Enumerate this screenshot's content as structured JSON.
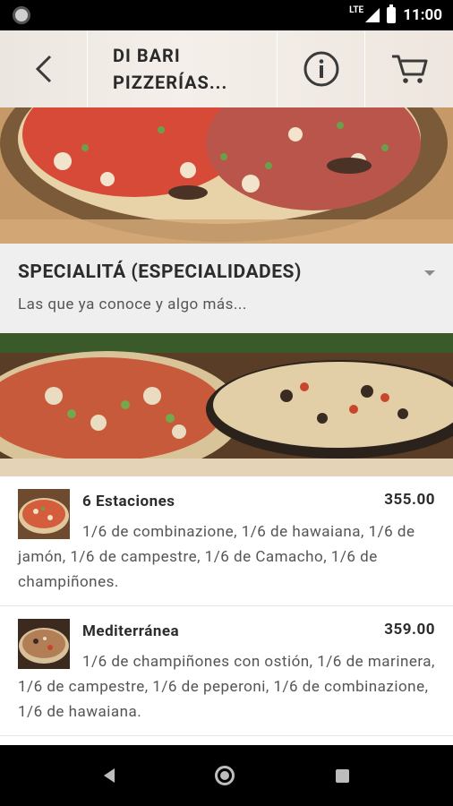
{
  "status_bar": {
    "network": "LTE",
    "time": "11:00"
  },
  "header": {
    "title": "DI BARI PIZZERÍAS...",
    "back_icon": "back-arrow-icon",
    "info_icon": "info-icon",
    "cart_icon": "cart-icon"
  },
  "section": {
    "title": "SPECIALITÁ (ESPECIALIDADES)",
    "subtitle": "Las que ya conoce y algo más...",
    "toggle_icon": "dropdown-arrow-icon"
  },
  "items": [
    {
      "name": "6 Estaciones",
      "price": "355.00",
      "description": "1/6 de combinazione, 1/6 de hawaiana, 1/6 de jamón, 1/6 de campestre, 1/6 de Camacho, 1/6 de champiñones."
    },
    {
      "name": "Mediterránea",
      "price": "359.00",
      "description": "1/6 de champiñones con ostión, 1/6 de marinera, 1/6 de campestre, 1/6 de peperoni, 1/6 de combinazione, 1/6 de hawaiana."
    }
  ],
  "nav": {
    "back": "nav-back-icon",
    "home": "nav-home-icon",
    "recents": "nav-recents-icon"
  }
}
